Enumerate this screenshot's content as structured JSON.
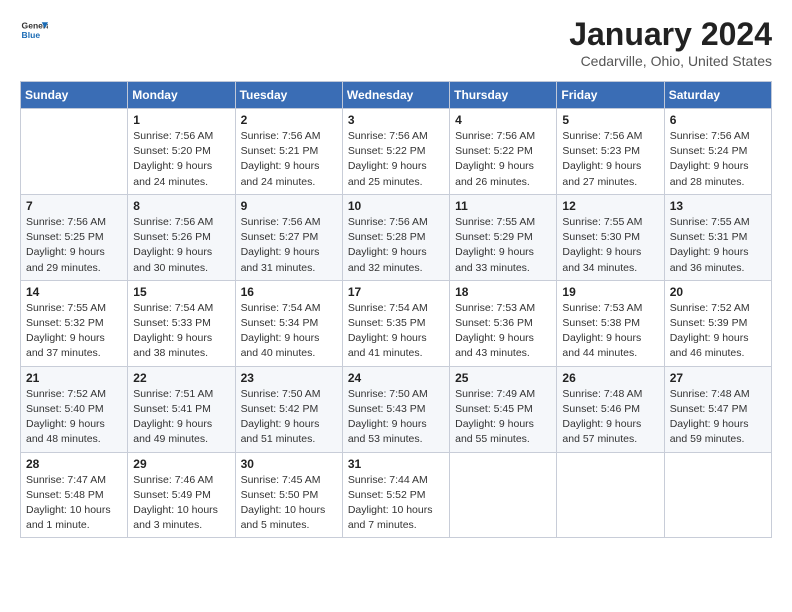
{
  "header": {
    "logo_line1": "General",
    "logo_line2": "Blue",
    "title": "January 2024",
    "subtitle": "Cedarville, Ohio, United States"
  },
  "weekdays": [
    "Sunday",
    "Monday",
    "Tuesday",
    "Wednesday",
    "Thursday",
    "Friday",
    "Saturday"
  ],
  "weeks": [
    [
      {
        "day": "",
        "info": ""
      },
      {
        "day": "1",
        "info": "Sunrise: 7:56 AM\nSunset: 5:20 PM\nDaylight: 9 hours\nand 24 minutes."
      },
      {
        "day": "2",
        "info": "Sunrise: 7:56 AM\nSunset: 5:21 PM\nDaylight: 9 hours\nand 24 minutes."
      },
      {
        "day": "3",
        "info": "Sunrise: 7:56 AM\nSunset: 5:22 PM\nDaylight: 9 hours\nand 25 minutes."
      },
      {
        "day": "4",
        "info": "Sunrise: 7:56 AM\nSunset: 5:22 PM\nDaylight: 9 hours\nand 26 minutes."
      },
      {
        "day": "5",
        "info": "Sunrise: 7:56 AM\nSunset: 5:23 PM\nDaylight: 9 hours\nand 27 minutes."
      },
      {
        "day": "6",
        "info": "Sunrise: 7:56 AM\nSunset: 5:24 PM\nDaylight: 9 hours\nand 28 minutes."
      }
    ],
    [
      {
        "day": "7",
        "info": "Sunrise: 7:56 AM\nSunset: 5:25 PM\nDaylight: 9 hours\nand 29 minutes."
      },
      {
        "day": "8",
        "info": "Sunrise: 7:56 AM\nSunset: 5:26 PM\nDaylight: 9 hours\nand 30 minutes."
      },
      {
        "day": "9",
        "info": "Sunrise: 7:56 AM\nSunset: 5:27 PM\nDaylight: 9 hours\nand 31 minutes."
      },
      {
        "day": "10",
        "info": "Sunrise: 7:56 AM\nSunset: 5:28 PM\nDaylight: 9 hours\nand 32 minutes."
      },
      {
        "day": "11",
        "info": "Sunrise: 7:55 AM\nSunset: 5:29 PM\nDaylight: 9 hours\nand 33 minutes."
      },
      {
        "day": "12",
        "info": "Sunrise: 7:55 AM\nSunset: 5:30 PM\nDaylight: 9 hours\nand 34 minutes."
      },
      {
        "day": "13",
        "info": "Sunrise: 7:55 AM\nSunset: 5:31 PM\nDaylight: 9 hours\nand 36 minutes."
      }
    ],
    [
      {
        "day": "14",
        "info": "Sunrise: 7:55 AM\nSunset: 5:32 PM\nDaylight: 9 hours\nand 37 minutes."
      },
      {
        "day": "15",
        "info": "Sunrise: 7:54 AM\nSunset: 5:33 PM\nDaylight: 9 hours\nand 38 minutes."
      },
      {
        "day": "16",
        "info": "Sunrise: 7:54 AM\nSunset: 5:34 PM\nDaylight: 9 hours\nand 40 minutes."
      },
      {
        "day": "17",
        "info": "Sunrise: 7:54 AM\nSunset: 5:35 PM\nDaylight: 9 hours\nand 41 minutes."
      },
      {
        "day": "18",
        "info": "Sunrise: 7:53 AM\nSunset: 5:36 PM\nDaylight: 9 hours\nand 43 minutes."
      },
      {
        "day": "19",
        "info": "Sunrise: 7:53 AM\nSunset: 5:38 PM\nDaylight: 9 hours\nand 44 minutes."
      },
      {
        "day": "20",
        "info": "Sunrise: 7:52 AM\nSunset: 5:39 PM\nDaylight: 9 hours\nand 46 minutes."
      }
    ],
    [
      {
        "day": "21",
        "info": "Sunrise: 7:52 AM\nSunset: 5:40 PM\nDaylight: 9 hours\nand 48 minutes."
      },
      {
        "day": "22",
        "info": "Sunrise: 7:51 AM\nSunset: 5:41 PM\nDaylight: 9 hours\nand 49 minutes."
      },
      {
        "day": "23",
        "info": "Sunrise: 7:50 AM\nSunset: 5:42 PM\nDaylight: 9 hours\nand 51 minutes."
      },
      {
        "day": "24",
        "info": "Sunrise: 7:50 AM\nSunset: 5:43 PM\nDaylight: 9 hours\nand 53 minutes."
      },
      {
        "day": "25",
        "info": "Sunrise: 7:49 AM\nSunset: 5:45 PM\nDaylight: 9 hours\nand 55 minutes."
      },
      {
        "day": "26",
        "info": "Sunrise: 7:48 AM\nSunset: 5:46 PM\nDaylight: 9 hours\nand 57 minutes."
      },
      {
        "day": "27",
        "info": "Sunrise: 7:48 AM\nSunset: 5:47 PM\nDaylight: 9 hours\nand 59 minutes."
      }
    ],
    [
      {
        "day": "28",
        "info": "Sunrise: 7:47 AM\nSunset: 5:48 PM\nDaylight: 10 hours\nand 1 minute."
      },
      {
        "day": "29",
        "info": "Sunrise: 7:46 AM\nSunset: 5:49 PM\nDaylight: 10 hours\nand 3 minutes."
      },
      {
        "day": "30",
        "info": "Sunrise: 7:45 AM\nSunset: 5:50 PM\nDaylight: 10 hours\nand 5 minutes."
      },
      {
        "day": "31",
        "info": "Sunrise: 7:44 AM\nSunset: 5:52 PM\nDaylight: 10 hours\nand 7 minutes."
      },
      {
        "day": "",
        "info": ""
      },
      {
        "day": "",
        "info": ""
      },
      {
        "day": "",
        "info": ""
      }
    ]
  ]
}
